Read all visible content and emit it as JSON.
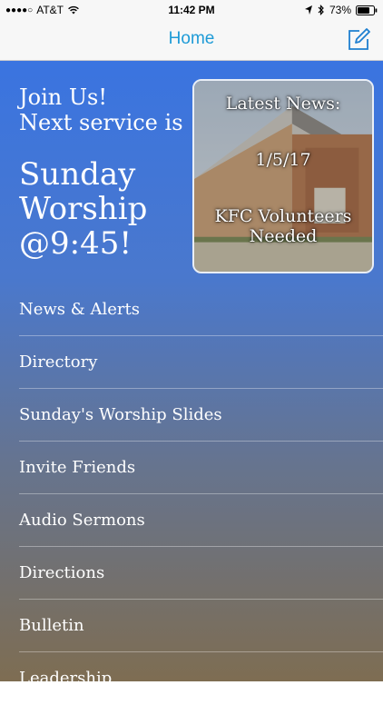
{
  "status_bar": {
    "carrier": "AT&T",
    "time": "11:42 PM",
    "battery": "73%"
  },
  "nav": {
    "title": "Home",
    "compose_icon": "compose-icon"
  },
  "hero": {
    "join_line1": "Join Us!",
    "join_line2": "Next service is",
    "worship_line1": "Sunday",
    "worship_line2": "Worship",
    "worship_line3": "@9:45!"
  },
  "news_card": {
    "title": "Latest News:",
    "date": "1/5/17",
    "headline": "KFC Volunteers Needed"
  },
  "menu": {
    "items": [
      {
        "label": "News & Alerts"
      },
      {
        "label": "Directory"
      },
      {
        "label": "Sunday's Worship Slides"
      },
      {
        "label": "Invite Friends"
      },
      {
        "label": "Audio Sermons"
      },
      {
        "label": "Directions"
      },
      {
        "label": "Bulletin"
      },
      {
        "label": "Leadership"
      }
    ]
  },
  "colors": {
    "nav_title": "#1e9bd7",
    "gradient_top": "#3a74e0",
    "gradient_bottom": "#7e6d52"
  }
}
